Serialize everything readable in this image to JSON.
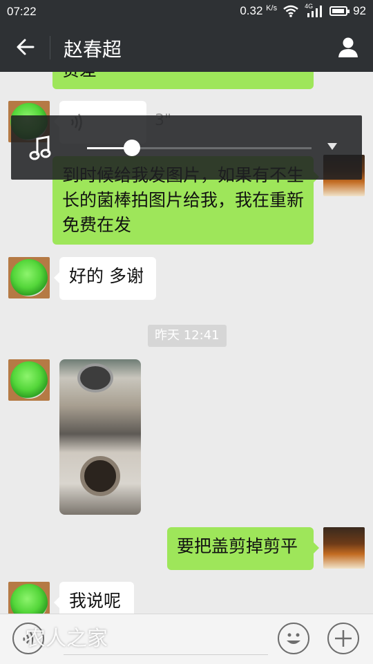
{
  "status_bar": {
    "time": "07:22",
    "speed": "0.32",
    "speed_unit": "K/s",
    "network": "4G",
    "battery": "92"
  },
  "header": {
    "title": "赵春超"
  },
  "messages": {
    "partial_text": "贵差",
    "voice_duration": "3\"",
    "sent_text_1": "到时候给我发图片，如果有不生长的菌棒拍图片给我，我在重新免费在发",
    "recv_text_1": "好的 多谢",
    "timestamp": "昨天 12:41",
    "sent_text_2": "要把盖剪掉剪平",
    "recv_text_2": "我说呢"
  },
  "player": {
    "progress": 0.2
  },
  "input_bar": {
    "watermark": "农人之家"
  },
  "colors": {
    "header_bg": "#2e3134",
    "sent_bubble": "#9ee65a",
    "received_bubble": "#ffffff",
    "chat_bg": "#ebebeb"
  }
}
